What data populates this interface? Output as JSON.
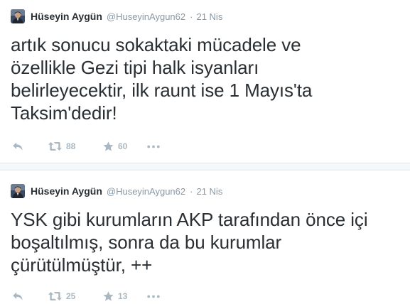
{
  "tweets": [
    {
      "author": {
        "fullname": "Hüseyin Aygün",
        "username": "@HuseyinAygun62"
      },
      "separator": "·",
      "time": "21 Nis",
      "text_lines": [
        "artık sonucu sokaktaki mücadele ve",
        "özellikle Gezi tipi halk isyanları",
        "belirleyecektir, ilk raunt ise 1 Mayıs'ta",
        "Taksim'dedir!"
      ],
      "retweets": "88",
      "favorites": "60"
    },
    {
      "author": {
        "fullname": "Hüseyin Aygün",
        "username": "@HuseyinAygun62"
      },
      "separator": "·",
      "time": "21 Nis",
      "text_lines": [
        "YSK gibi kurumların AKP tarafından önce içi",
        "boşaltılmış, sonra da bu kurumlar",
        "çürütülmüştür, ++"
      ],
      "retweets": "25",
      "favorites": "13"
    }
  ],
  "icons": {
    "reply": "reply-icon",
    "retweet": "retweet-icon",
    "favorite": "star-icon",
    "more": "more-dots-icon"
  },
  "colors": {
    "text": "#292f33",
    "muted": "#8899a6",
    "action": "#aab8c2",
    "border": "#e1e8ed",
    "gap": "#f5f8fa"
  }
}
